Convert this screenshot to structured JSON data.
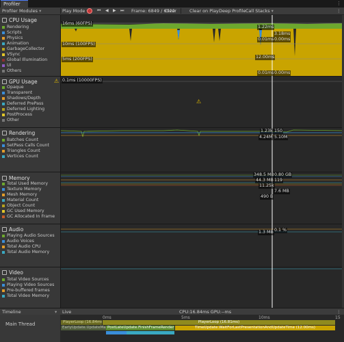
{
  "window": {
    "tab_title": "Profiler",
    "menu_glyph": "⋮"
  },
  "toolbar": {
    "modules_label": "Profiler Modules",
    "mode_label": "Play Mode",
    "frame_label": "Frame: 6849 / 6920",
    "clear_label": "Clear",
    "clear_on_play_label": "Clear on Play",
    "deep_profile_label": "Deep Profile",
    "call_stacks_label": "Call Stacks",
    "more_glyph": "⋮",
    "step_back_glyph": "◀",
    "step_fwd_glyph": "▶",
    "first_glyph": "⏮",
    "last_glyph": "⏭"
  },
  "modules": [
    {
      "title": "CPU Usage",
      "items": [
        {
          "label": "Rendering",
          "color": "#6da82e"
        },
        {
          "label": "Scripts",
          "color": "#3a8ed9"
        },
        {
          "label": "Physics",
          "color": "#e29c2a"
        },
        {
          "label": "Animation",
          "color": "#3aa9c2"
        },
        {
          "label": "GarbageCollector",
          "color": "#b6a21f"
        },
        {
          "label": "VSync",
          "color": "#e2c72a"
        },
        {
          "label": "Global Illumination",
          "color": "#8a2f2f"
        },
        {
          "label": "UI",
          "color": "#8f5cc8"
        },
        {
          "label": "Others",
          "color": "#777777"
        }
      ]
    },
    {
      "title": "GPU Usage",
      "warning": "⚠",
      "items": [
        {
          "label": "Opaque",
          "color": "#6da82e"
        },
        {
          "label": "Transparent",
          "color": "#3a8ed9"
        },
        {
          "label": "Shadows/Depth",
          "color": "#e29c2a"
        },
        {
          "label": "Deferred PrePass",
          "color": "#3aa9c2"
        },
        {
          "label": "Deferred Lighting",
          "color": "#b6a21f"
        },
        {
          "label": "PostProcess",
          "color": "#e2c72a"
        },
        {
          "label": "Other",
          "color": "#777777"
        }
      ]
    },
    {
      "title": "Rendering",
      "items": [
        {
          "label": "Batches Count",
          "color": "#6da82e"
        },
        {
          "label": "SetPass Calls Count",
          "color": "#3a8ed9"
        },
        {
          "label": "Triangles Count",
          "color": "#e29c2a"
        },
        {
          "label": "Vertices Count",
          "color": "#3aa9c2"
        }
      ]
    },
    {
      "title": "Memory",
      "items": [
        {
          "label": "Total Used Memory",
          "color": "#6da82e"
        },
        {
          "label": "Texture Memory",
          "color": "#3a8ed9"
        },
        {
          "label": "Mesh Memory",
          "color": "#e29c2a"
        },
        {
          "label": "Material Count",
          "color": "#3aa9c2"
        },
        {
          "label": "Object Count",
          "color": "#b6a21f"
        },
        {
          "label": "GC Used Memory",
          "color": "#e2c72a"
        },
        {
          "label": "GC Allocated In Frame",
          "color": "#c85c2a"
        }
      ]
    },
    {
      "title": "Audio",
      "items": [
        {
          "label": "Playing Audio Sources",
          "color": "#6da82e"
        },
        {
          "label": "Audio Voices",
          "color": "#3a8ed9"
        },
        {
          "label": "Total Audio CPU",
          "color": "#e29c2a"
        },
        {
          "label": "Total Audio Memory",
          "color": "#3aa9c2"
        }
      ]
    },
    {
      "title": "Video",
      "items": [
        {
          "label": "Total Video Sources",
          "color": "#6da82e"
        },
        {
          "label": "Playing Video Sources",
          "color": "#3a8ed9"
        },
        {
          "label": "Pre-buffered frames",
          "color": "#e29c2a"
        },
        {
          "label": "Total Video Memory",
          "color": "#3aa9c2"
        }
      ]
    }
  ],
  "cpu_graph": {
    "lines": [
      "16ms (60FPS)",
      "10ms (100FPS)",
      "5ms (200FPS)"
    ],
    "values": [
      "1.22ms",
      "3.18ms",
      "0.01ms",
      "0.00ms",
      "12.00ms",
      "0.01ms",
      "0.00ms"
    ]
  },
  "gpu_graph": {
    "line": "0.1ms (10000FPS)",
    "warning": "⚠"
  },
  "rendering_graph": {
    "values": [
      "1.23k",
      "150",
      "4.24M",
      "5.10M"
    ]
  },
  "memory_graph": {
    "values": [
      "348.5 MB",
      "0.80 GB",
      "44.3 MB",
      "119",
      "11.25k",
      "7.6 MB",
      "490 B"
    ]
  },
  "audio_graph": {
    "values": [
      "0.1 %",
      "1.3 MB"
    ]
  },
  "timeline": {
    "view_label": "Timeline",
    "live_label": "Live",
    "cpu_gpu_label": "CPU:16.84ms   GPU:--ms",
    "thread_label": "Main Thread",
    "ticks": [
      "0ms",
      "5ms",
      "10ms",
      "15"
    ],
    "bars": [
      "PlayerLoop (16.84ms)",
      "PlayerLoop (16.81ms)",
      "EarlyUpdate.UpdateMainGameViewRect",
      "PostLateUpdate.FinishFrameRendering (4.0",
      "TimeUpdate.WaitForLastPresentationAndUpdateTime (12.00ms)"
    ]
  }
}
